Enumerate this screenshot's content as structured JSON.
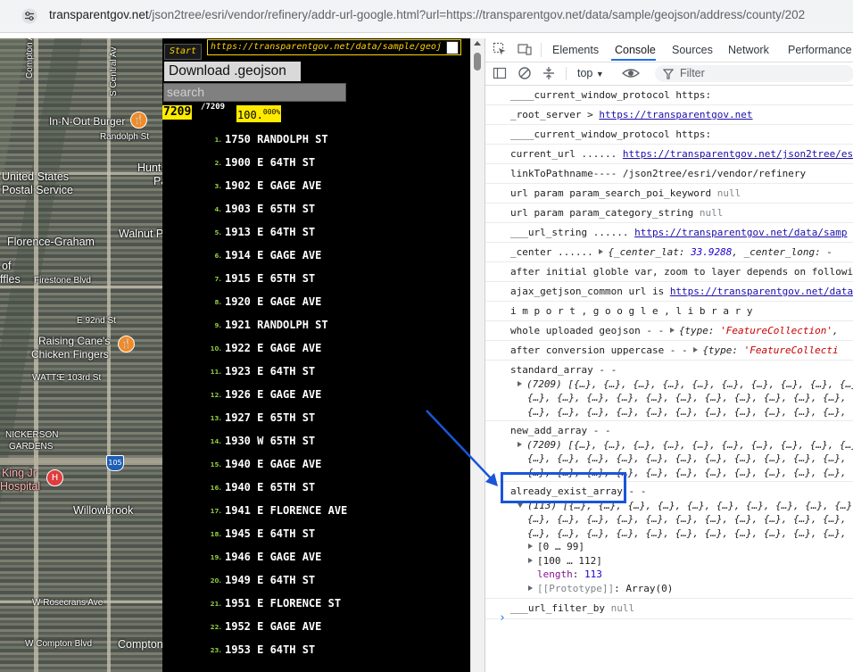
{
  "browser": {
    "url_host": "transparentgov.net",
    "url_path": "/json2tree/esri/vendor/refinery/addr-url-google.html?url=https://transparentgov.net/data/sample/geojson/address/county/202"
  },
  "map": {
    "labels": [
      "Compton Av",
      "S Central Av",
      "Randolph St",
      "In-N-Out Burger",
      "United States",
      "Postal Service",
      "Hunt",
      "Pa",
      "Walnut P",
      "Florence-Graham",
      "of",
      "ffles",
      "Firestone Blvd",
      "E 92nd St",
      "Raising Cane's",
      "Chicken Fingers",
      "WATTS",
      "E 103rd St",
      "NICKERSON",
      "GARDENS",
      "King Jr",
      "Hospital",
      "Willowbrook",
      "W Rosecrans Ave",
      "W Compton Blvd",
      "Compton",
      "105"
    ]
  },
  "list": {
    "start_label": "Start",
    "url_value": "https://transparentgov.net/data/sample/geoj",
    "download_label": "Download .geojson",
    "search_placeholder": "search",
    "count_total": "7209",
    "count_slash": "/7209",
    "percent": "100.",
    "percent_decimals": "000%",
    "addresses": [
      {
        "n": "1.",
        "a": "1750 RANDOLPH ST"
      },
      {
        "n": "2.",
        "a": "1900 E 64TH ST"
      },
      {
        "n": "3.",
        "a": "1902 E GAGE AVE"
      },
      {
        "n": "4.",
        "a": "1903 E 65TH ST"
      },
      {
        "n": "5.",
        "a": "1913 E 64TH ST"
      },
      {
        "n": "6.",
        "a": "1914 E GAGE AVE"
      },
      {
        "n": "7.",
        "a": "1915 E 65TH ST"
      },
      {
        "n": "8.",
        "a": "1920 E GAGE AVE"
      },
      {
        "n": "9.",
        "a": "1921 RANDOLPH ST"
      },
      {
        "n": "10.",
        "a": "1922 E GAGE AVE"
      },
      {
        "n": "11.",
        "a": "1923 E 64TH ST"
      },
      {
        "n": "12.",
        "a": "1926 E GAGE AVE"
      },
      {
        "n": "13.",
        "a": "1927 E 65TH ST"
      },
      {
        "n": "14.",
        "a": "1930 W 65TH ST"
      },
      {
        "n": "15.",
        "a": "1940 E GAGE AVE"
      },
      {
        "n": "16.",
        "a": "1940 E 65TH ST"
      },
      {
        "n": "17.",
        "a": "1941 E FLORENCE AVE"
      },
      {
        "n": "18.",
        "a": "1945 E 64TH ST"
      },
      {
        "n": "19.",
        "a": "1946 E GAGE AVE"
      },
      {
        "n": "20.",
        "a": "1949 E 64TH ST"
      },
      {
        "n": "21.",
        "a": "1951 E FLORENCE ST"
      },
      {
        "n": "22.",
        "a": "1952 E GAGE AVE"
      },
      {
        "n": "23.",
        "a": "1953 E 64TH ST"
      }
    ]
  },
  "devtools": {
    "tabs": [
      "Elements",
      "Console",
      "Sources",
      "Network",
      "Performance"
    ],
    "active_tab": "Console",
    "context": "top",
    "filter_placeholder": "Filter",
    "console": [
      {
        "t": "____current_window_protocol https:"
      },
      {
        "t": "_root_server > ",
        "link": "https://transparentgov.net"
      },
      {
        "t": "____current_window_protocol https:"
      },
      {
        "t": "current_url ......  ",
        "link": "https://transparentgov.net/json2tree/esr"
      },
      {
        "t": "linkToPathname---- /json2tree/esri/vendor/refinery"
      },
      {
        "t": "url param param_search_poi_keyword ",
        "nul": "null"
      },
      {
        "t": "url param param_category_string ",
        "nul": "null"
      },
      {
        "t": "___url_string ......   ",
        "link": "https://transparentgov.net/data/samp"
      },
      {
        "t": "_center ......  ",
        "obj_pre": "{_center_lat: ",
        "num": "33.9288",
        "obj_post": ", _center_long: -"
      },
      {
        "t": " after initial globle var, zoom to layer depends on followi"
      },
      {
        "t": "ajax_getjson_common url is  ",
        "link": "https://transparentgov.net/data"
      },
      {
        "t": "i m p o r t , g o o g l e ,  l i b r a r y"
      },
      {
        "t": "whole uploaded geojson  - -  ",
        "obj_pre": "{type: ",
        "str": "'FeatureCollection'",
        "obj_post": ","
      },
      {
        "t": "after conversion uppercase  - -  ",
        "obj_pre": "{type: ",
        "str": "'FeatureCollecti",
        "obj_post": ""
      }
    ],
    "standard_array_label": "standard_array  - -",
    "standard_array_head": "(7209) [{…}, {…}, {…}, {…}, {…}, {…}, {…}, {…}, {…}, {…},",
    "new_add_array_label": "new_add_array  - -",
    "new_add_array_head": "(7209) [{…}, {…}, {…}, {…}, {…}, {…}, {…}, {…}, {…}, {…},",
    "already_exist_label": "already_exist_array",
    "already_exist_dashes": " - -",
    "already_exist_head": "(113) [{…}, {…}, {…}, {…}, {…}, {…}, {…}, {…}, {…}, {…},",
    "objs_line": "{…}, {…}, {…}, {…}, {…}, {…}, {…}, {…}, {…}, {…}, {…}, {…},",
    "range_1": "[0 … 99]",
    "range_2": "[100 … 112]",
    "length_key": "length",
    "length_val": "113",
    "prototype_key": "[[Prototype]]",
    "prototype_val": "Array(0)",
    "url_filter_label": "___url_filter_by ",
    "url_filter_val": "null",
    "prompt": "›"
  },
  "colors": {
    "accent": "#1a73e8",
    "annotation": "#1956d8",
    "list_yellow": "#ffeb00",
    "list_green": "#8ec63f"
  }
}
